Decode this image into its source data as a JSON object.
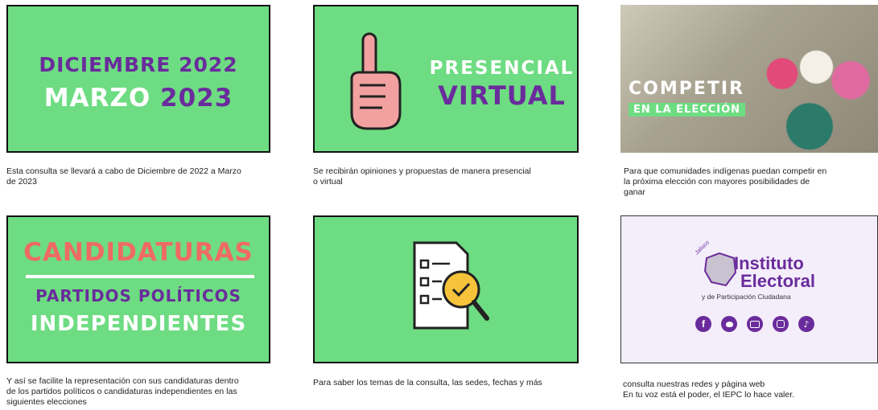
{
  "colors": {
    "green": "#6edc82",
    "purple": "#6a2c9c",
    "white": "#ffffff",
    "coral": "#ef6a64",
    "lilac_bg": "#f4eefb"
  },
  "cards": [
    {
      "line1": "DICIEMBRE 2022",
      "line2a": "MARZO",
      "line2b": "2023",
      "caption": "Esta consulta se llevará a cabo de Diciembre de 2022 a Marzo\nde 2023"
    },
    {
      "line1": "PRESENCIAL",
      "line2": "VIRTUAL",
      "icon": "hand-one-finger-icon",
      "caption": "Se recibirán opiniones y propuestas de manera presencial\no virtual"
    },
    {
      "line1": "COMPETIR",
      "line2": "EN LA ELECCIÓN",
      "caption": "Para que comunidades indígenas puedan competir en\nla próxima elección con mayores posibilidades de\nganar"
    },
    {
      "line1": "CANDIDATURAS",
      "line2": "PARTIDOS POLÍTICOS",
      "line3": "INDEPENDIENTES",
      "caption": "Y  así se facilite la representación con sus candidaturas dentro\nde los partidos políticos o candidaturas independientes en las\nsiguientes elecciones"
    },
    {
      "icon": "checklist-magnifier-icon",
      "caption": "Para saber los temas de la consulta, las sedes, fechas y más"
    },
    {
      "logo_small": "Jalisco",
      "logo_line1": "Instituto",
      "logo_line2": "Electoral",
      "logo_line3": "y de Participación Ciudadana",
      "social_icons": [
        "facebook-icon",
        "twitter-icon",
        "youtube-icon",
        "instagram-icon",
        "tiktok-icon"
      ],
      "caption": "consulta nuestras redes y página web\nEn tu voz está el poder, el IEPC lo hace valer."
    }
  ]
}
